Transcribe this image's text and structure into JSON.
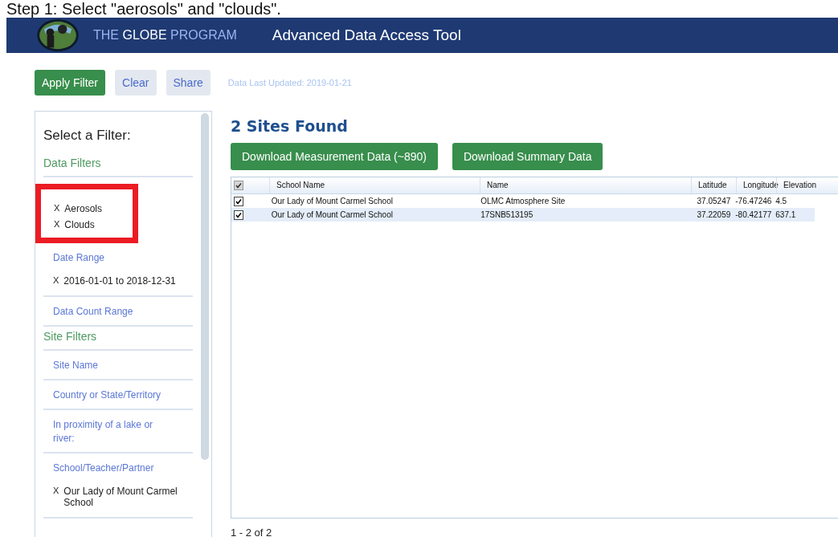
{
  "caption": "Step 1: Select \"aerosols\" and \"clouds\".",
  "header": {
    "brand_prefix": "THE",
    "brand_main": "GLOBE",
    "brand_suffix": "PROGRAM",
    "title": "Advanced Data Access Tool"
  },
  "toolbar": {
    "buttons": [
      {
        "label": "Apply Filter",
        "kind": "primary"
      },
      {
        "label": "Clear",
        "kind": "secondary"
      },
      {
        "label": "Share",
        "kind": "secondary"
      }
    ],
    "updated": "Data Last Updated: 2019-01-21"
  },
  "sidebar": {
    "title": "Select a Filter:",
    "sections": [
      {
        "kind": "group",
        "label": "Data Filters"
      },
      {
        "kind": "chips",
        "highlighted": true,
        "items": [
          {
            "remove": "X",
            "label": "Aerosols"
          },
          {
            "remove": "X",
            "label": "Clouds"
          }
        ]
      },
      {
        "kind": "filter",
        "label": "Date Range",
        "items": [
          {
            "remove": "X",
            "label": "2016-01-01 to 2018-12-31"
          }
        ]
      },
      {
        "kind": "filter",
        "label": "Data Count Range"
      },
      {
        "kind": "group",
        "label": "Site Filters"
      },
      {
        "kind": "filter",
        "label": "Site Name"
      },
      {
        "kind": "filter",
        "label": "Country or State/Territory"
      },
      {
        "kind": "filter",
        "label": "In proximity of a lake or river:"
      },
      {
        "kind": "filter",
        "label": "School/Teacher/Partner",
        "items": [
          {
            "remove": "X",
            "label": "Our Lady of Mount Carmel School"
          }
        ]
      }
    ]
  },
  "results": {
    "heading": "2 Sites Found",
    "buttons": [
      "Download Measurement Data (~890)",
      "Download Summary Data"
    ],
    "table": {
      "all_checked": true,
      "columns": [
        "School Name",
        "Name",
        "Latitude",
        "Longitude",
        "Elevation"
      ],
      "rows": [
        {
          "checked": true,
          "selected": false,
          "cells": [
            "Our Lady of Mount Carmel School",
            "OLMC Atmosphere Site",
            "37.05247",
            "-76.47246",
            "4.5"
          ]
        },
        {
          "checked": true,
          "selected": true,
          "cells": [
            "Our Lady of Mount Carmel School",
            "17SNB513195",
            "37.22059",
            "-80.42177",
            "637.1"
          ]
        }
      ]
    },
    "pager": "1 - 2 of 2"
  }
}
